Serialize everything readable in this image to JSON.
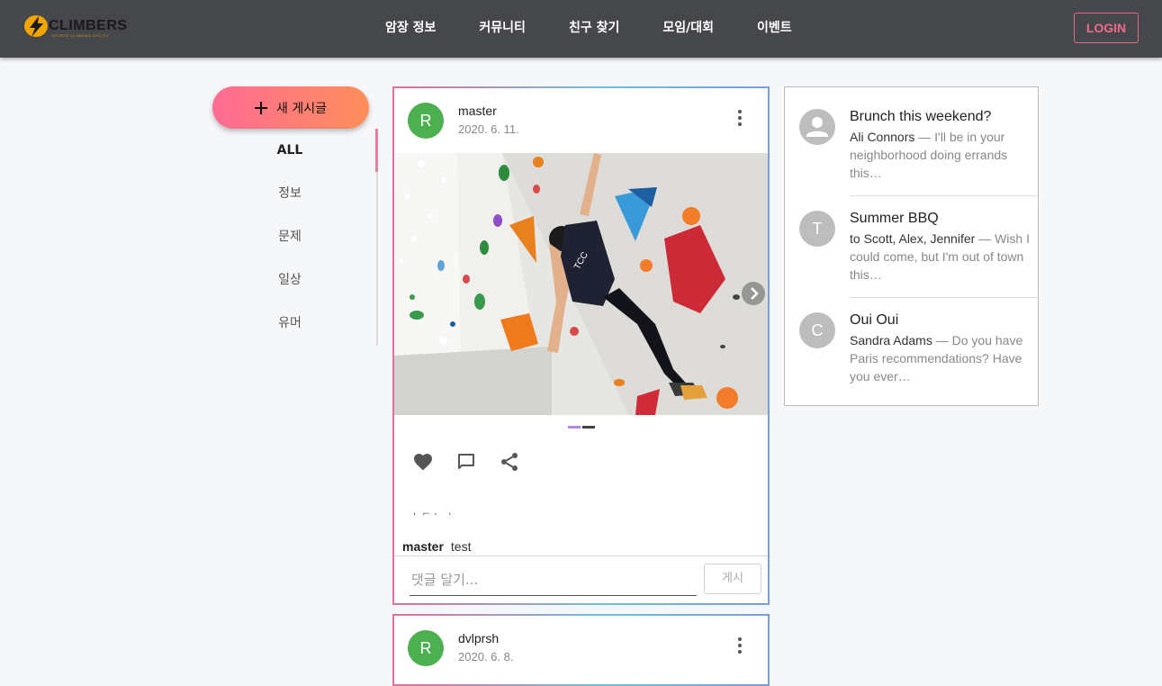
{
  "header": {
    "logo_text": "CLIMBERS",
    "logo_subtext": "SPORTS CLIMBING UTILITY",
    "nav": [
      "암장 정보",
      "커뮤니티",
      "친구 찾기",
      "모임/대회",
      "이벤트"
    ],
    "login_label": "LOGIN"
  },
  "sidebar": {
    "new_post_label": "새 게시글",
    "categories": [
      "ALL",
      "정보",
      "문제",
      "일상",
      "유머"
    ],
    "active_category": "ALL"
  },
  "posts": [
    {
      "avatar_letter": "R",
      "avatar_color": "#4caf50",
      "username": "master",
      "date": "2020. 6. 11.",
      "image_alt": "climber on bouldering wall",
      "carousel": {
        "slides": 2,
        "active": 1
      },
      "actions": [
        "heart-icon",
        "comment-icon",
        "share-icon"
      ],
      "truncated_text": "ㅅㄷㄴㅅ",
      "caption_user": "master",
      "caption_text": "test",
      "comment_placeholder": "댓글 달기...",
      "comment_value": "",
      "submit_label": "게시"
    },
    {
      "avatar_letter": "R",
      "avatar_color": "#4caf50",
      "username": "dvlprsh",
      "date": "2020. 6. 8."
    }
  ],
  "messages": [
    {
      "avatar": "person-icon",
      "title": "Brunch this weekend?",
      "from": "Ali Connors",
      "text": "I'll be in your neighborhood doing errands this…"
    },
    {
      "avatar": "T",
      "title": "Summer BBQ",
      "from": "to Scott, Alex, Jennifer",
      "text": "Wish I could come, but I'm out of town this…"
    },
    {
      "avatar": "C",
      "title": "Oui Oui",
      "from": "Sandra Adams",
      "text": "Do you have Paris recommendations? Have you ever…"
    }
  ],
  "colors": {
    "header_bg": "#45474b",
    "accent_pink": "#f06a8b",
    "new_post_gradient": [
      "#ff6b95",
      "#ff8f59"
    ],
    "avatar_green": "#4caf50",
    "avatar_grey": "#bdbdbd"
  }
}
